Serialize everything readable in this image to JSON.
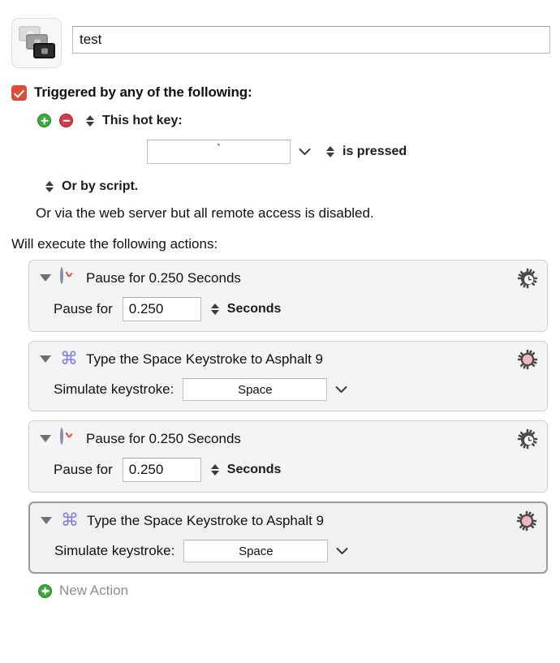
{
  "macro": {
    "icon_name": "macro-keycaps-icon",
    "name_value": "test",
    "name_placeholder": "Macro Name"
  },
  "trigger": {
    "checkbox_checked": true,
    "checkbox_label": "Triggered by any of the following:",
    "add_icon": "plus-circle-icon",
    "remove_icon": "minus-circle-icon",
    "hotkey_popup_label": "This hot key:",
    "hotkey_value": "`",
    "hotkey_placeholder": "",
    "modifier_label": "is pressed",
    "script_label": "Or by script.",
    "web_server_note": "Or via the web server but all remote access is disabled."
  },
  "actions_header": "Will execute the following actions:",
  "actions": [
    {
      "icon": "clock-icon",
      "title": "Pause for 0.250 Seconds",
      "gear_icon": "gear-clock-icon",
      "gear_variant": "clock",
      "body_label": "Pause for",
      "value": "0.250",
      "unit": "Seconds",
      "selected": false,
      "type": "pause"
    },
    {
      "icon": "command-icon",
      "title": "Type the Space Keystroke to Asphalt 9",
      "gear_icon": "gear-pink-icon",
      "gear_variant": "pink",
      "body_label": "Simulate keystroke:",
      "value": "Space",
      "unit": "",
      "selected": false,
      "type": "keystroke"
    },
    {
      "icon": "clock-icon",
      "title": "Pause for 0.250 Seconds",
      "gear_icon": "gear-clock-icon",
      "gear_variant": "clock",
      "body_label": "Pause for",
      "value": "0.250",
      "unit": "Seconds",
      "selected": false,
      "type": "pause"
    },
    {
      "icon": "command-icon",
      "title": "Type the Space Keystroke to Asphalt 9",
      "gear_icon": "gear-pink-icon",
      "gear_variant": "pink",
      "body_label": "Simulate keystroke:",
      "value": "Space",
      "unit": "",
      "selected": true,
      "type": "keystroke"
    }
  ],
  "new_action": {
    "icon": "plus-circle-icon",
    "label": "New Action"
  },
  "colors": {
    "checkbox_red": "#dd4b39",
    "add_green": "#3ba93b",
    "remove_red": "#cf3b4a",
    "command_purple": "#7b7ee8",
    "gear_dark": "#4a4a4a",
    "gear_pink": "#f3b8bd",
    "panel_bg": "#f4f4f4",
    "muted_text": "#8e8e8e"
  }
}
